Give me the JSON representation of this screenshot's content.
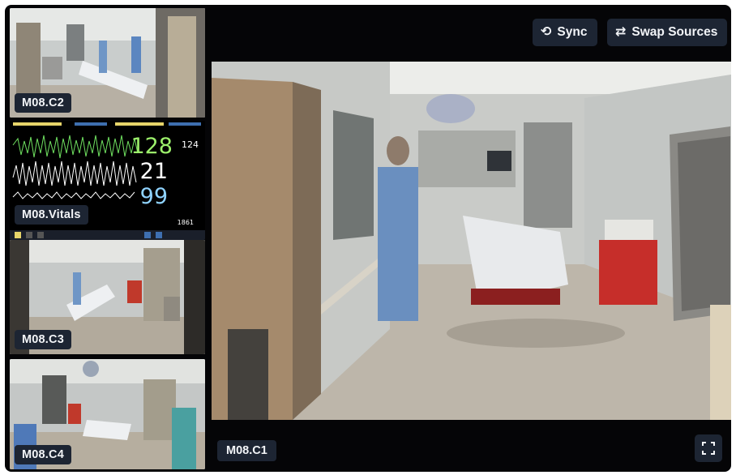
{
  "toolbar": {
    "sync_label": "Sync",
    "sync_icon": "sync-icon",
    "swap_label": "Swap Sources",
    "swap_icon": "swap-arrows-icon",
    "fullscreen_icon": "fullscreen-icon"
  },
  "thumbnails": [
    {
      "label": "M08.C2"
    },
    {
      "label": "M08.Vitals"
    },
    {
      "label": "M08.C3"
    },
    {
      "label": "M08.C4"
    }
  ],
  "vitals": {
    "heart_rate": "128",
    "heart_rate_small": "124",
    "spo2": "21",
    "resp": "99",
    "small_value": "1861"
  },
  "main": {
    "label": "M08.C1"
  },
  "colors": {
    "background": "#050507",
    "badge": "#1d2533",
    "hr_green": "#9cf06b",
    "resp_blue": "#8fd3ff"
  }
}
